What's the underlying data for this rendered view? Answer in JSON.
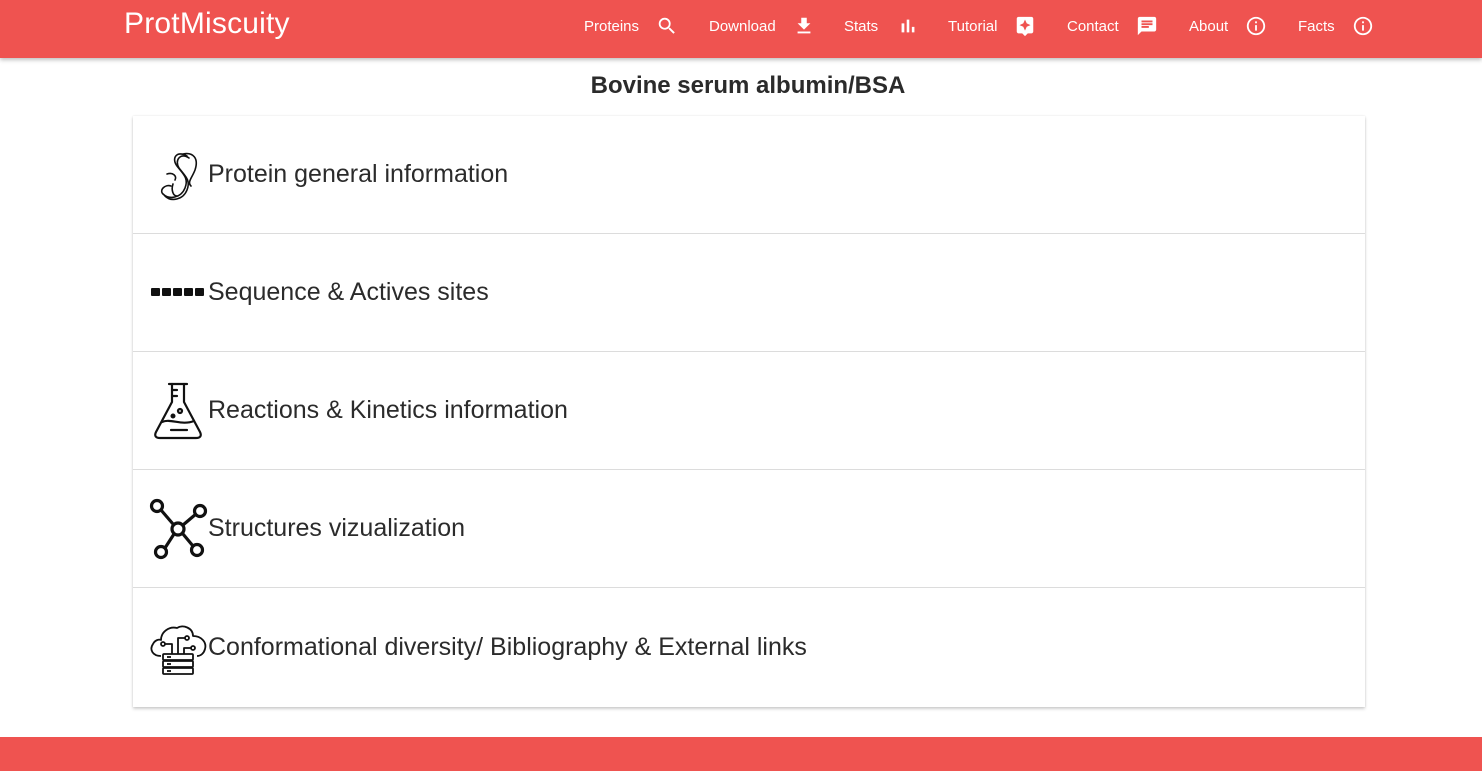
{
  "brand": "ProtMiscuity",
  "nav": [
    {
      "label": "Proteins",
      "icon": "search-icon"
    },
    {
      "label": "Download",
      "icon": "download-icon"
    },
    {
      "label": "Stats",
      "icon": "bar-chart-icon"
    },
    {
      "label": "Tutorial",
      "icon": "tutorial-icon"
    },
    {
      "label": "Contact",
      "icon": "chat-icon"
    },
    {
      "label": "About",
      "icon": "info-icon"
    },
    {
      "label": "Facts",
      "icon": "info-icon"
    }
  ],
  "title": "Bovine serum albumin/BSA",
  "sections": [
    {
      "label": "Protein general information",
      "icon": "protein-ribbon-icon"
    },
    {
      "label": "Sequence & Actives sites",
      "icon": "sequence-blocks-icon"
    },
    {
      "label": "Reactions & Kinetics information",
      "icon": "flask-icon"
    },
    {
      "label": "Structures vizualization",
      "icon": "molecule-icon"
    },
    {
      "label": "Conformational diversity/ Bibliography & External links",
      "icon": "cloud-server-icon"
    }
  ],
  "colors": {
    "brand": "#ef5350",
    "text": "#2b2b2b",
    "nav_text": "#ffffff"
  }
}
